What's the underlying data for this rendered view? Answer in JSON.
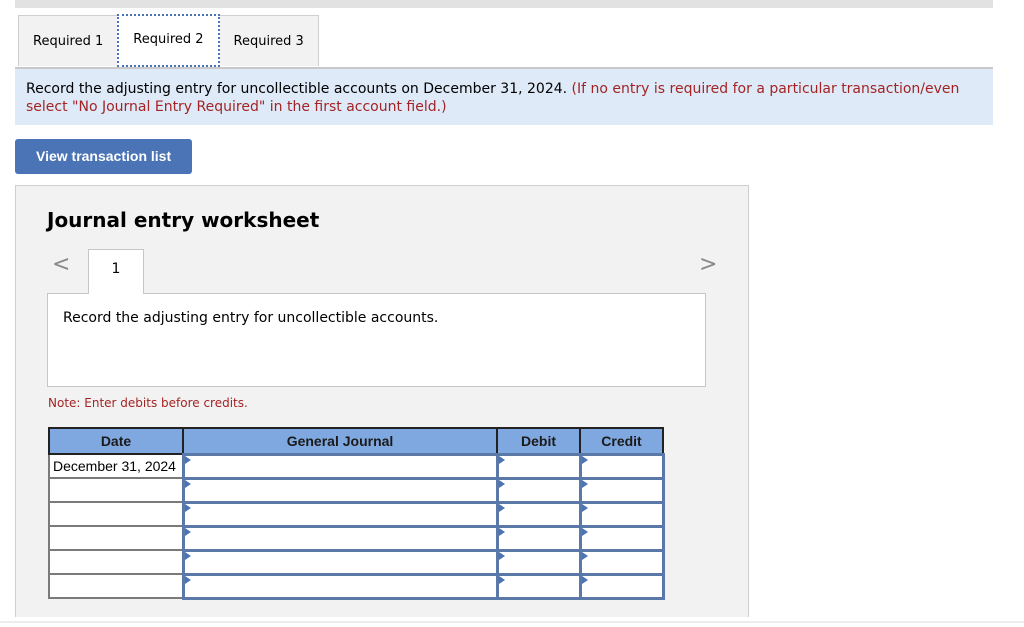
{
  "tabs": [
    {
      "label": "Required 1",
      "active": false
    },
    {
      "label": "Required 2",
      "active": true
    },
    {
      "label": "Required 3",
      "active": false
    }
  ],
  "instruction": {
    "main": "Record the adjusting entry for uncollectible accounts on December 31, 2024.",
    "hint_line1": "(If no entry is required for a particular transaction/even",
    "hint_line2": "select \"No Journal Entry Required\" in the first account field.)"
  },
  "view_transaction_button": "View transaction list",
  "worksheet": {
    "title": "Journal entry worksheet",
    "prev_icon": "<",
    "next_icon": ">",
    "current_page": "1",
    "description": "Record the adjusting entry for uncollectible accounts.",
    "note": "Note: Enter debits before credits.",
    "table": {
      "headers": [
        "Date",
        "General Journal",
        "Debit",
        "Credit"
      ],
      "rows": [
        {
          "date": "December 31, 2024",
          "account": "",
          "debit": "",
          "credit": ""
        },
        {
          "date": "",
          "account": "",
          "debit": "",
          "credit": ""
        },
        {
          "date": "",
          "account": "",
          "debit": "",
          "credit": ""
        },
        {
          "date": "",
          "account": "",
          "debit": "",
          "credit": ""
        },
        {
          "date": "",
          "account": "",
          "debit": "",
          "credit": ""
        },
        {
          "date": "",
          "account": "",
          "debit": "",
          "credit": ""
        }
      ]
    }
  }
}
